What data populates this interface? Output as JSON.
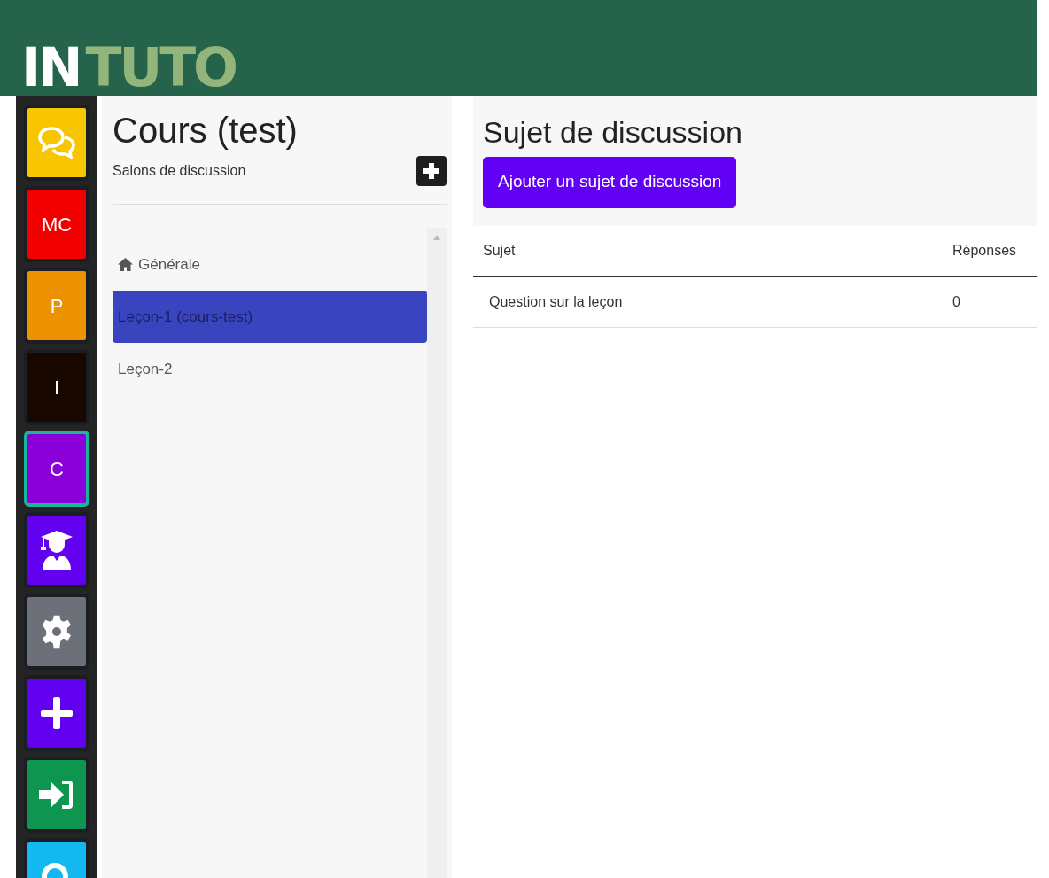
{
  "logo": {
    "part_1": "IN",
    "part_2": "TUTO"
  },
  "rail": [
    {
      "kind": "chat",
      "color": "#f7c600",
      "selected": false
    },
    {
      "kind": "text",
      "label": "MC",
      "color": "#f20000",
      "selected": false
    },
    {
      "kind": "text",
      "label": "P",
      "color": "#ec9200",
      "selected": false
    },
    {
      "kind": "text",
      "label": "I",
      "color": "#190800",
      "selected": false
    },
    {
      "kind": "text",
      "label": "C",
      "color": "#8a00d9",
      "selected": true
    },
    {
      "kind": "graduate",
      "color": "#6200f0",
      "selected": false
    },
    {
      "kind": "gear",
      "color": "#6c7079",
      "selected": false
    },
    {
      "kind": "plus",
      "color": "#6200f0",
      "selected": false
    },
    {
      "kind": "signin",
      "color": "#0e9550",
      "selected": false
    },
    {
      "kind": "search",
      "color": "#12b8f0",
      "selected": false
    }
  ],
  "sidebar": {
    "title": "Cours (test)",
    "subtitle": "Salons de discussion",
    "items": [
      {
        "label": "Générale",
        "home": true,
        "selected": false
      },
      {
        "label": "Leçon-1 (cours-test)",
        "home": false,
        "selected": true
      },
      {
        "label": "Leçon-2",
        "home": false,
        "selected": false
      }
    ]
  },
  "main": {
    "title": "Sujet de discussion",
    "add_button": "Ajouter un sujet de discussion",
    "table": {
      "columns": [
        "Sujet",
        "Réponses"
      ],
      "rows": [
        [
          "Question sur la leçon",
          "0"
        ]
      ]
    }
  }
}
